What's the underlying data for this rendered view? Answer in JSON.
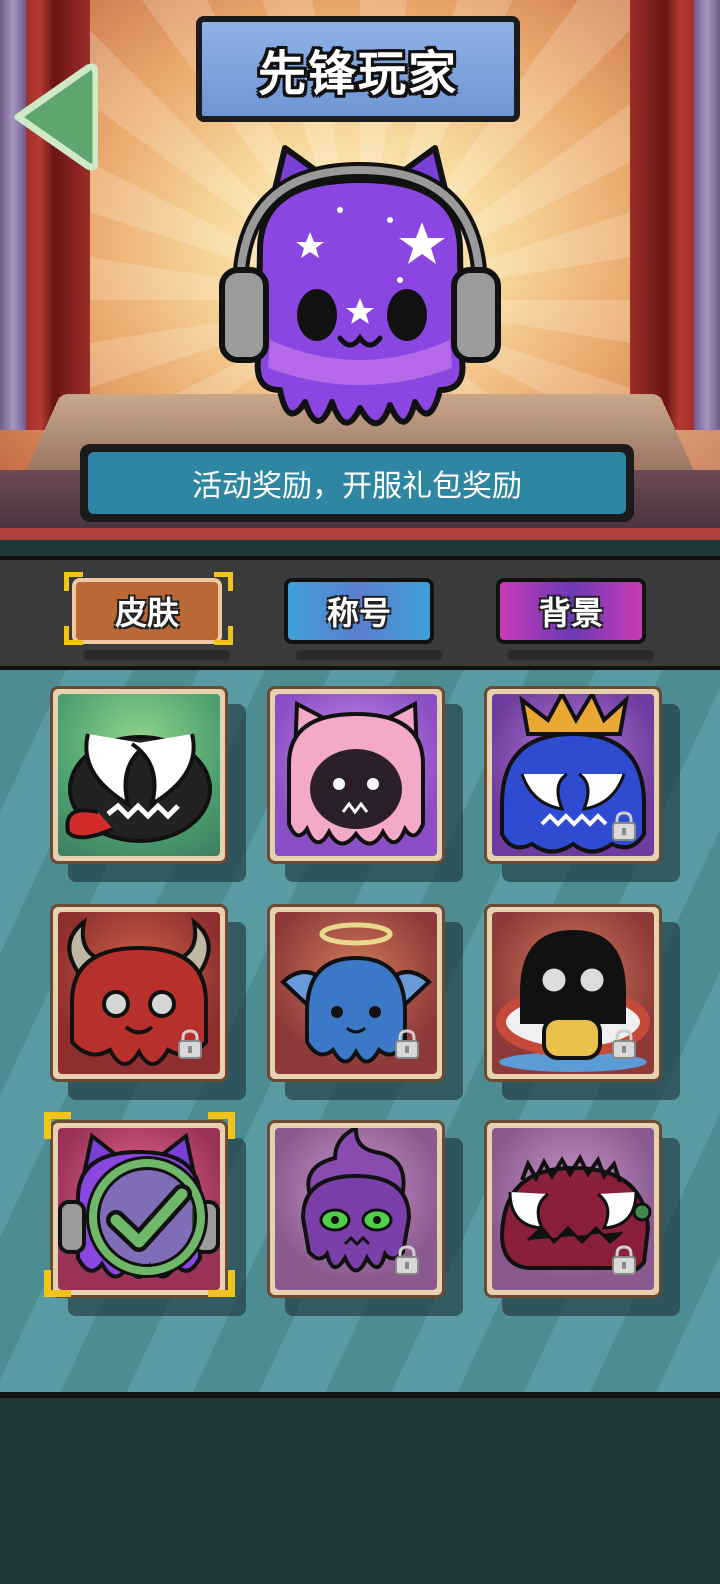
{
  "header": {
    "title": "先锋玩家",
    "description": "活动奖励，开服礼包奖励"
  },
  "tabs": [
    {
      "id": "skin",
      "label": "皮肤",
      "selected": true
    },
    {
      "id": "title",
      "label": "称号",
      "selected": false
    },
    {
      "id": "background",
      "label": "背景",
      "selected": false
    }
  ],
  "skins": [
    {
      "name": "venom-black",
      "locked": false,
      "equipped": false
    },
    {
      "name": "pink-kitty",
      "locked": false,
      "equipped": false
    },
    {
      "name": "blue-king",
      "locked": true,
      "equipped": false
    },
    {
      "name": "red-devil",
      "locked": true,
      "equipped": false
    },
    {
      "name": "blue-angel",
      "locked": true,
      "equipped": false
    },
    {
      "name": "cow-ring",
      "locked": true,
      "equipped": false
    },
    {
      "name": "purple-star-cat",
      "locked": false,
      "equipped": true
    },
    {
      "name": "purple-flame-skull",
      "locked": true,
      "equipped": false
    },
    {
      "name": "spiky-red-venom",
      "locked": true,
      "equipped": false
    }
  ],
  "colors": {
    "title_plate": "#7a9fdc",
    "description_bar": "#2f86a3",
    "tab_skin": "#b96836",
    "tab_title": "#4f8fd4",
    "tab_background": "#8a3ab6",
    "selected_bracket": "#f2c318",
    "checkmark": "#6fb86a"
  }
}
